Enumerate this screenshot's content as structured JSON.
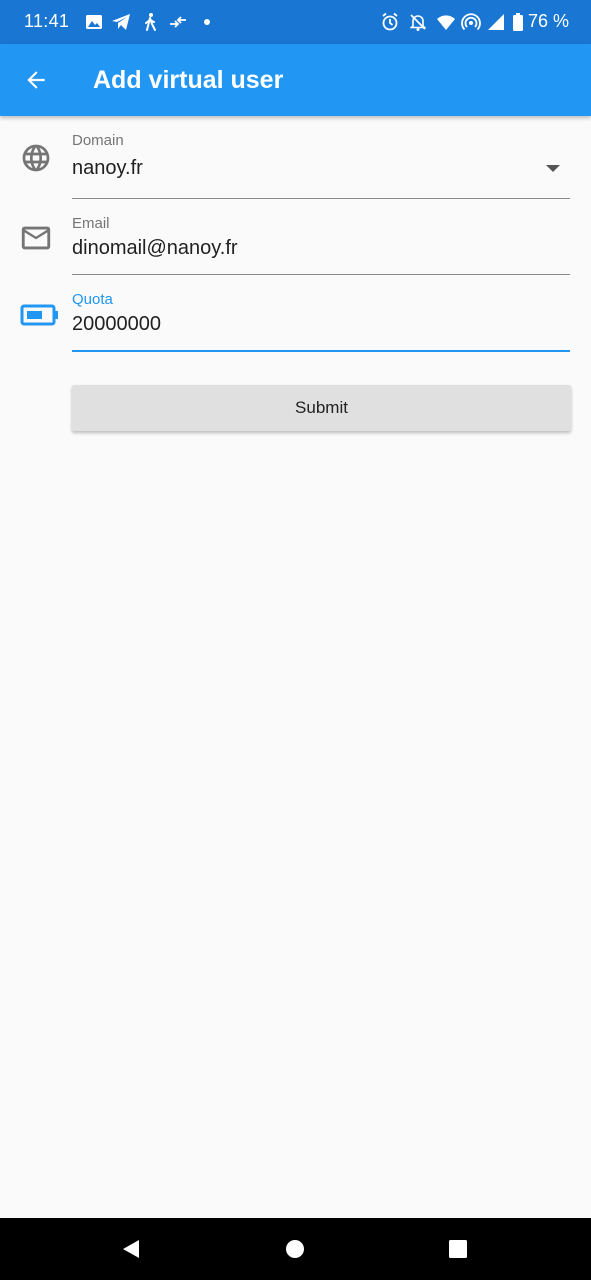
{
  "status_bar": {
    "time": "11:41",
    "battery_percent": "76 %",
    "left_icons": [
      "image-icon",
      "telegram-icon",
      "walking-icon",
      "arrows-icon",
      "dot-icon"
    ],
    "right_icons": [
      "alarm-icon",
      "notifications-off-icon",
      "wifi-icon",
      "hotspot-icon",
      "signal-icon",
      "battery-icon"
    ]
  },
  "app_bar": {
    "title": "Add virtual user",
    "background": "#2196f3"
  },
  "form": {
    "domain": {
      "label": "Domain",
      "value": "nanoy.fr",
      "icon": "globe-icon"
    },
    "email": {
      "label": "Email",
      "value": "dinomail@nanoy.fr",
      "icon": "mail-icon"
    },
    "quota": {
      "label": "Quota",
      "value": "20000000",
      "icon": "battery-icon",
      "focused": true
    },
    "submit_label": "Submit"
  },
  "nav_bar": {
    "buttons": [
      "back-triangle-icon",
      "home-circle-icon",
      "recents-square-icon"
    ]
  },
  "colors": {
    "status_bar": "#1976d2",
    "accent": "#2196f3",
    "button": "#e0e0e0"
  }
}
